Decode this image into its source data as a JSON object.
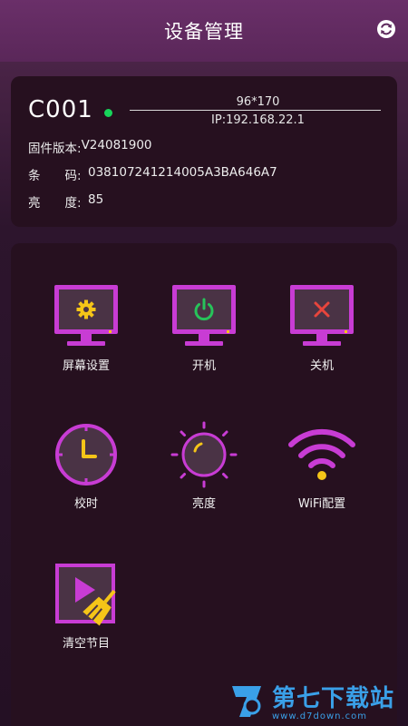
{
  "header": {
    "title": "设备管理",
    "refresh_icon": "refresh-icon"
  },
  "device": {
    "id": "C001",
    "status_color": "#17d45a",
    "resolution": "96*170",
    "ip": "IP:192.168.22.1",
    "firmware_label": "固件版本:",
    "firmware_value": "V24081900",
    "barcode_label": "条　　码:",
    "barcode_value": "038107241214005A3BA646A7",
    "brightness_label": "亮　　度:",
    "brightness_value": "85"
  },
  "functions": [
    {
      "label": "屏幕设置",
      "icon": "screen-settings-icon"
    },
    {
      "label": "开机",
      "icon": "power-on-icon"
    },
    {
      "label": "关机",
      "icon": "power-off-icon"
    },
    {
      "label": "校时",
      "icon": "clock-icon"
    },
    {
      "label": "亮度",
      "icon": "brightness-icon"
    },
    {
      "label": "WiFi配置",
      "icon": "wifi-icon"
    },
    {
      "label": "清空节目",
      "icon": "clear-program-icon"
    }
  ],
  "colors": {
    "accent": "#c83cd4",
    "header_bg": "#5e2a5d",
    "card_bg": "#26101f",
    "yellow": "#f5c518",
    "green": "#27c35a",
    "red": "#e8453c"
  },
  "watermark": {
    "main": "第七下载站",
    "sub": "www.d7down.com"
  }
}
